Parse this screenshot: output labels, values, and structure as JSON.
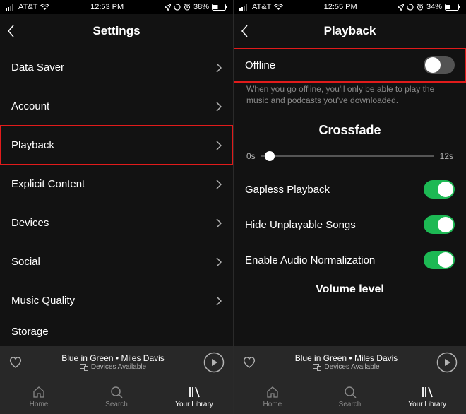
{
  "left": {
    "status": {
      "carrier": "AT&T",
      "time": "12:53 PM",
      "battery": "38%"
    },
    "title": "Settings",
    "rows": [
      {
        "label": "Data Saver"
      },
      {
        "label": "Account"
      },
      {
        "label": "Playback",
        "highlight": true
      },
      {
        "label": "Explicit Content"
      },
      {
        "label": "Devices"
      },
      {
        "label": "Social"
      },
      {
        "label": "Music Quality"
      }
    ],
    "storage_label": "Storage"
  },
  "right": {
    "status": {
      "carrier": "AT&T",
      "time": "12:55 PM",
      "battery": "34%"
    },
    "title": "Playback",
    "offline": {
      "label": "Offline",
      "on": false,
      "highlight": true
    },
    "offline_help": "When you go offline, you'll only be able to play the music and podcasts you've downloaded.",
    "crossfade": {
      "title": "Crossfade",
      "min_label": "0s",
      "max_label": "12s",
      "value_pct": 5
    },
    "toggles": [
      {
        "label": "Gapless Playback",
        "on": true
      },
      {
        "label": "Hide Unplayable Songs",
        "on": true
      },
      {
        "label": "Enable Audio Normalization",
        "on": true
      }
    ],
    "volume_section": "Volume level"
  },
  "nowplaying": {
    "track": "Blue in Green",
    "separator": " • ",
    "artist": "Miles Davis",
    "devices": "Devices Available"
  },
  "tabs": {
    "home": "Home",
    "search": "Search",
    "library": "Your Library"
  }
}
